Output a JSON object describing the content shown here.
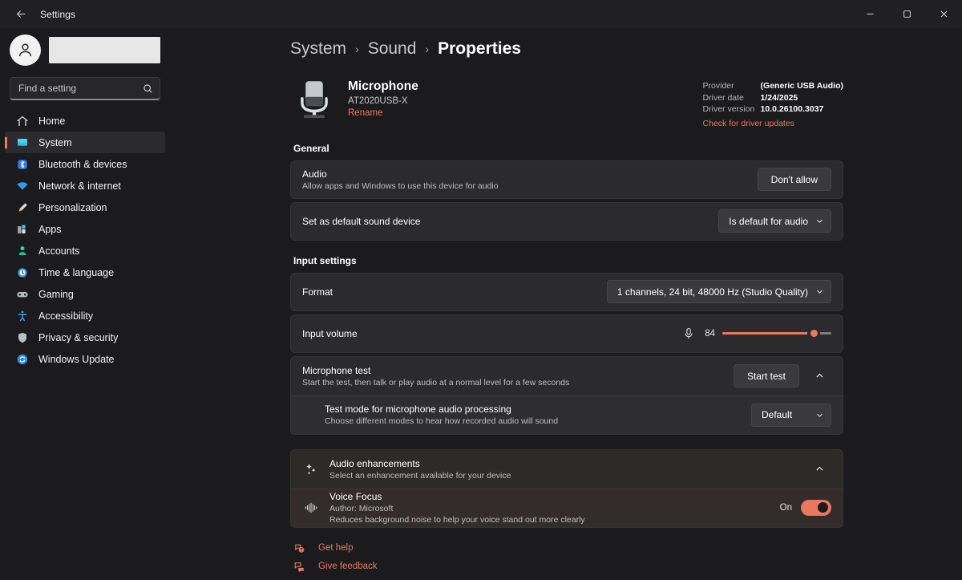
{
  "titlebar": {
    "back_icon": "arrow-left-icon",
    "title": "Settings",
    "minimize_label": "—",
    "maximize_label": "□",
    "close_label": "✕"
  },
  "sidebar": {
    "avatar_icon": "person-avatar-icon",
    "profile_name": "",
    "search": {
      "placeholder": "Find a setting",
      "value": "",
      "icon": "search-icon"
    },
    "items": [
      {
        "label": "Home",
        "icon": "home-icon",
        "selected": false
      },
      {
        "label": "System",
        "icon": "system-monitor-icon",
        "selected": true
      },
      {
        "label": "Bluetooth & devices",
        "icon": "bluetooth-icon",
        "selected": false
      },
      {
        "label": "Network & internet",
        "icon": "wifi-icon",
        "selected": false
      },
      {
        "label": "Personalization",
        "icon": "paintbrush-icon",
        "selected": false
      },
      {
        "label": "Apps",
        "icon": "apps-icon",
        "selected": false
      },
      {
        "label": "Accounts",
        "icon": "account-person-icon",
        "selected": false
      },
      {
        "label": "Time & language",
        "icon": "clock-icon",
        "selected": false
      },
      {
        "label": "Gaming",
        "icon": "gamepad-icon",
        "selected": false
      },
      {
        "label": "Accessibility",
        "icon": "accessibility-person-icon",
        "selected": false
      },
      {
        "label": "Privacy & security",
        "icon": "shield-icon",
        "selected": false
      },
      {
        "label": "Windows Update",
        "icon": "update-refresh-icon",
        "selected": false
      }
    ]
  },
  "breadcrumb": {
    "crumb1": "System",
    "crumb2": "Sound",
    "crumb3": "Properties",
    "separator": "›"
  },
  "device": {
    "icon": "studio-microphone-icon",
    "name": "Microphone",
    "model": "AT2020USB-X",
    "rename_label": "Rename",
    "driver": {
      "provider_key": "Provider",
      "provider_value": "(Generic USB Audio)",
      "date_key": "Driver date",
      "date_value": "1/24/2025",
      "version_key": "Driver version",
      "version_value": "10.0.26100.3037",
      "update_link": "Check for driver updates"
    }
  },
  "general": {
    "heading": "General",
    "audio": {
      "title": "Audio",
      "subtitle": "Allow apps and Windows to use this device for audio",
      "button": "Don't allow"
    },
    "default_device": {
      "title": "Set as default sound device",
      "dropdown_value": "Is default for audio"
    }
  },
  "input_settings": {
    "heading": "Input settings",
    "format": {
      "title": "Format",
      "dropdown_value": "1 channels, 24 bit, 48000 Hz (Studio Quality)"
    },
    "volume": {
      "title": "Input volume",
      "mic_icon": "microphone-icon",
      "value": "84",
      "percent": 84
    },
    "mic_test": {
      "title": "Microphone test",
      "subtitle": "Start the test, then talk or play audio at a normal level for a few seconds",
      "button": "Start test",
      "expanded": true,
      "test_mode": {
        "title": "Test mode for microphone audio processing",
        "subtitle": "Choose different modes to hear how recorded audio will sound",
        "dropdown_value": "Default"
      }
    }
  },
  "audio_enhancements": {
    "icon": "sparkle-icon",
    "title": "Audio enhancements",
    "subtitle": "Select an enhancement available for your device",
    "expanded": true,
    "voice_focus": {
      "icon": "voice-waveform-icon",
      "title": "Voice Focus",
      "author": "Author: Microsoft",
      "description": "Reduces background noise to help your voice stand out more clearly",
      "toggle_label": "On",
      "toggle_on": true
    }
  },
  "footer": {
    "get_help": {
      "label": "Get help",
      "icon": "help-question-icon"
    },
    "give_feedback": {
      "label": "Give feedback",
      "icon": "feedback-icon"
    }
  },
  "colors": {
    "accent": "#e8785e",
    "page_bg": "#1b1b1d",
    "card_bg": "#2b2b2d",
    "warm_card_bg": "#2e2a28"
  }
}
